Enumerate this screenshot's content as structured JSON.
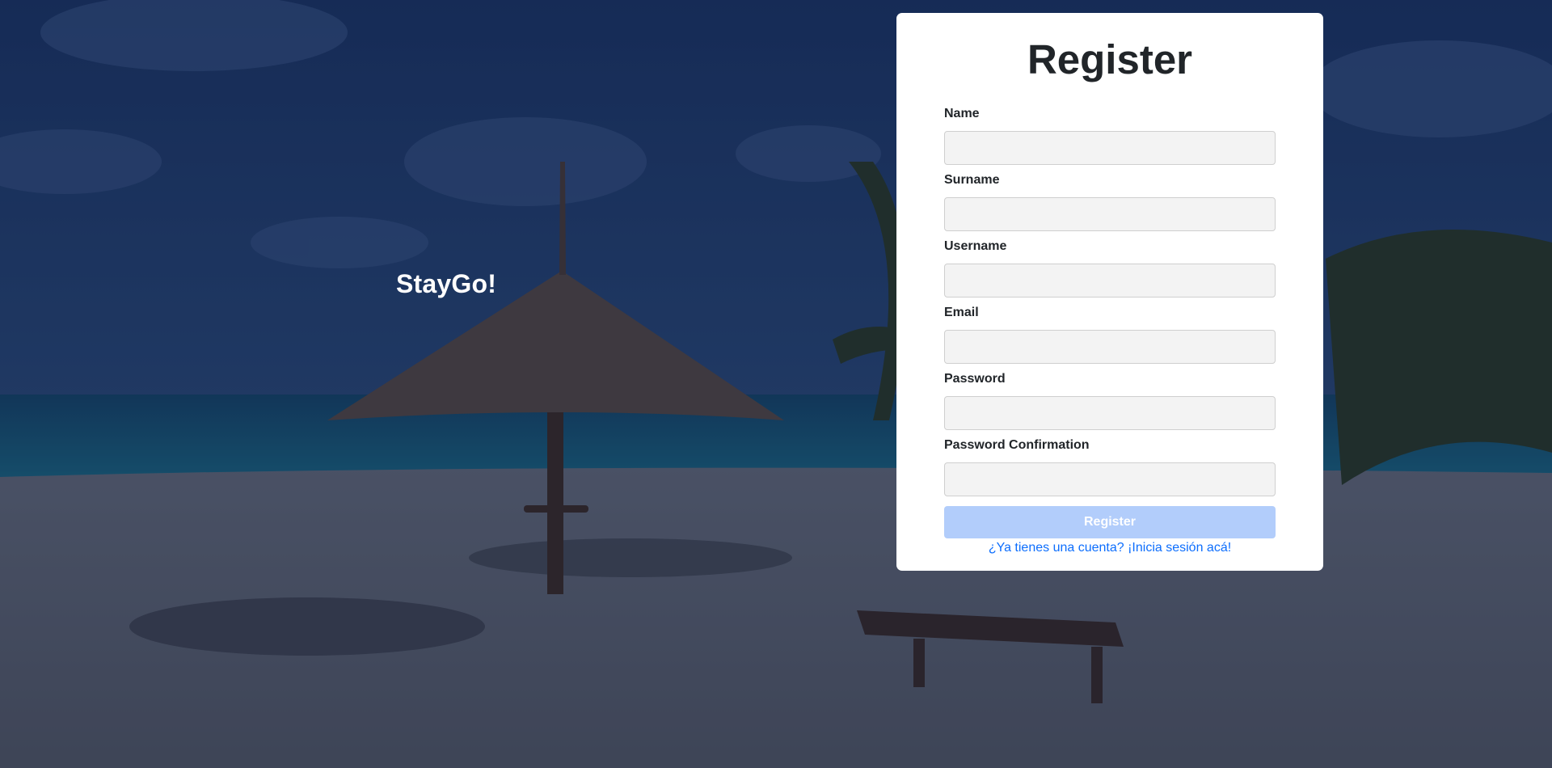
{
  "brand": {
    "name": "StayGo!"
  },
  "register": {
    "title": "Register",
    "fields": [
      {
        "label": "Name",
        "value": "",
        "placeholder": ""
      },
      {
        "label": "Surname",
        "value": "",
        "placeholder": ""
      },
      {
        "label": "Username",
        "value": "",
        "placeholder": ""
      },
      {
        "label": "Email",
        "value": "",
        "placeholder": ""
      },
      {
        "label": "Password",
        "value": "",
        "placeholder": ""
      },
      {
        "label": "Password Confirmation",
        "value": "",
        "placeholder": ""
      }
    ],
    "submit_label": "Register",
    "login_link": "¿Ya tienes una cuenta? ¡Inicia sesión acá!"
  },
  "colors": {
    "overlay": "#0b1a3a",
    "card_background": "#ffffff",
    "button_disabled": "#b2cdfb",
    "link": "#0d6efd",
    "text": "#212529"
  }
}
